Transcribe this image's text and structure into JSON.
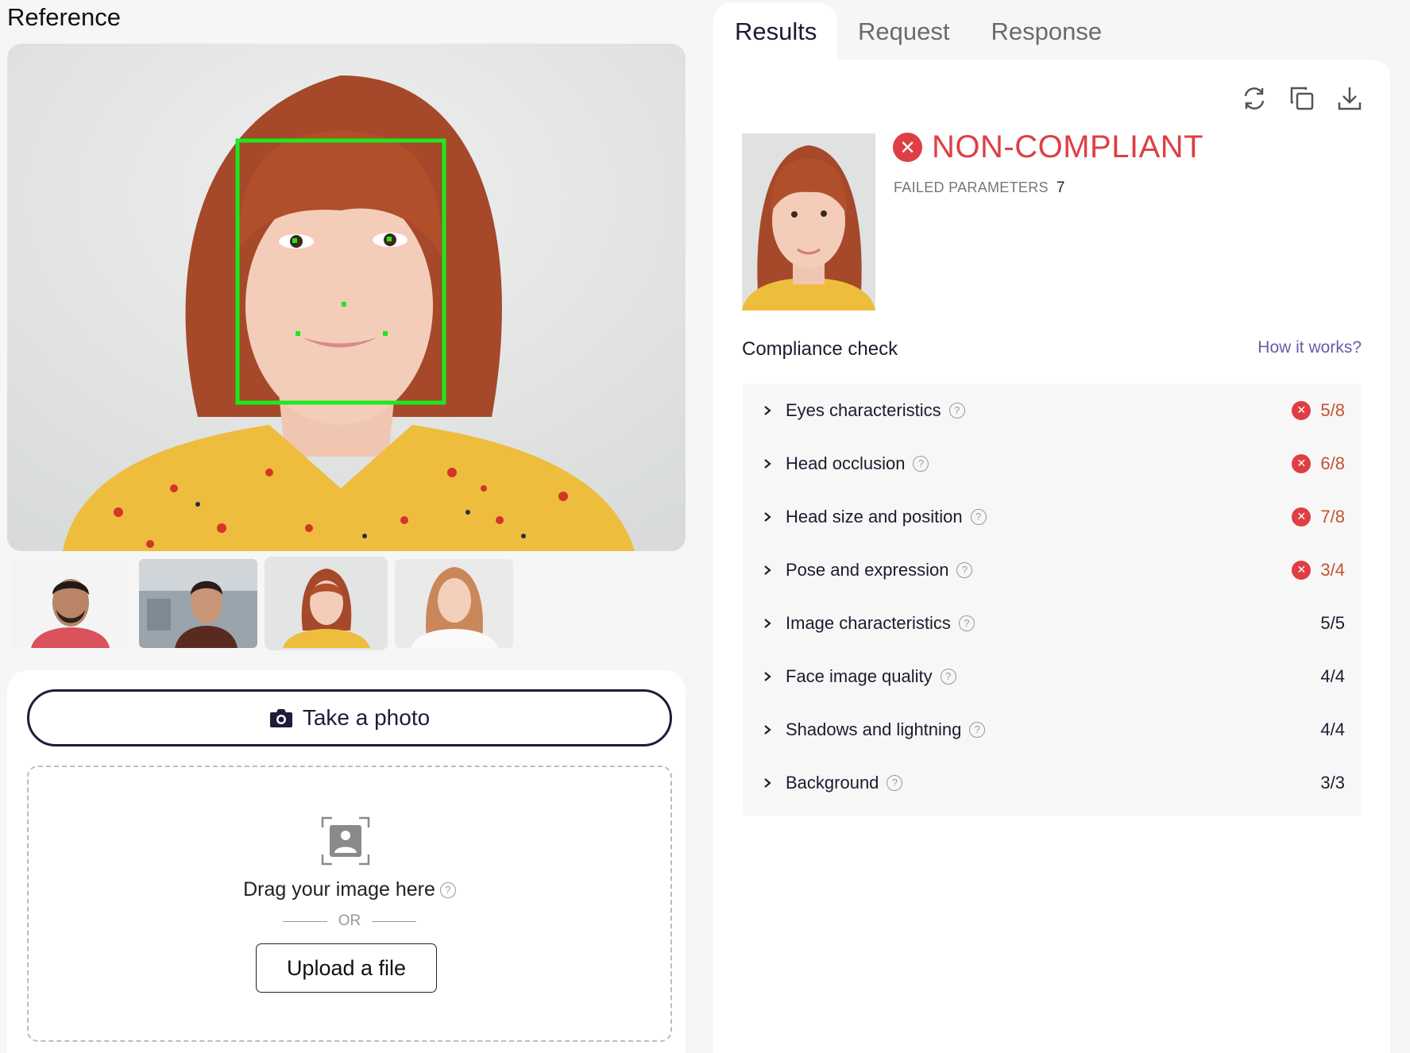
{
  "reference": {
    "title": "Reference",
    "thumbnails": [
      {
        "name": "thumb-man-red-shirt",
        "active": false
      },
      {
        "name": "thumb-man-office",
        "active": false
      },
      {
        "name": "thumb-woman-yellow",
        "active": true
      },
      {
        "name": "thumb-woman-smiling",
        "active": false
      }
    ]
  },
  "upload": {
    "take_photo_label": "Take a photo",
    "drag_text": "Drag your image here",
    "or_text": "OR",
    "upload_label": "Upload a file",
    "help_symbol": "?"
  },
  "tabs": [
    {
      "label": "Results",
      "active": true
    },
    {
      "label": "Request",
      "active": false
    },
    {
      "label": "Response",
      "active": false
    }
  ],
  "result": {
    "status": "NON-COMPLIANT",
    "status_color": "#de3f44",
    "status_icon": "x-circle-icon",
    "failed_label": "FAILED PARAMETERS",
    "failed_count": "7"
  },
  "compliance": {
    "title": "Compliance check",
    "how_link": "How it works?",
    "items": [
      {
        "label": "Eyes characteristics",
        "score": "5/8",
        "failed": true
      },
      {
        "label": "Head occlusion",
        "score": "6/8",
        "failed": true
      },
      {
        "label": "Head size and position",
        "score": "7/8",
        "failed": true
      },
      {
        "label": "Pose and expression",
        "score": "3/4",
        "failed": true
      },
      {
        "label": "Image characteristics",
        "score": "5/5",
        "failed": false
      },
      {
        "label": "Face image quality",
        "score": "4/4",
        "failed": false
      },
      {
        "label": "Shadows and lightning",
        "score": "4/4",
        "failed": false
      },
      {
        "label": "Background",
        "score": "3/3",
        "failed": false
      }
    ]
  },
  "colors": {
    "fail_red": "#de3f44",
    "fail_score": "#c45232",
    "link_purple": "#6b5aa8",
    "face_box_green": "#1ee81e",
    "button_navy": "#1d1c3a"
  }
}
